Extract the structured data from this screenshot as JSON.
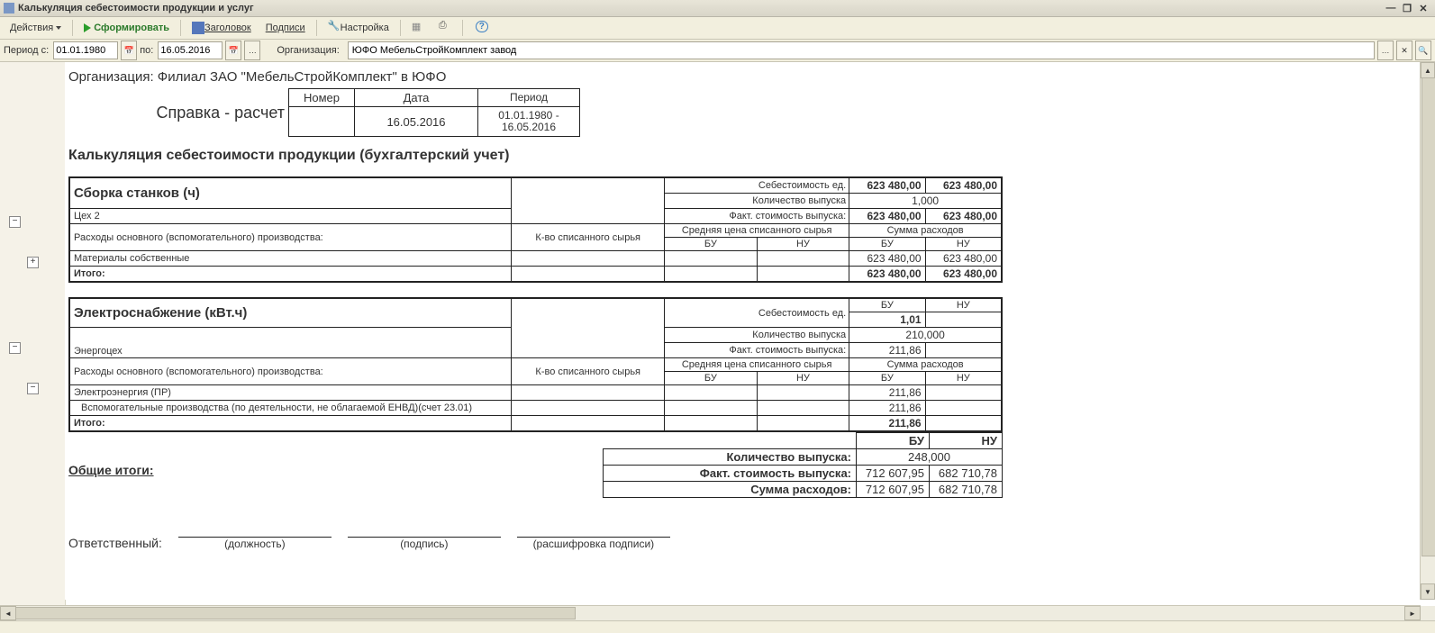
{
  "window": {
    "title": "Калькуляция себестоимости продукции и услуг"
  },
  "toolbar": {
    "actions": "Действия",
    "form": "Сформировать",
    "header": "Заголовок",
    "signatures": "Подписи",
    "setup": "Настройка"
  },
  "params": {
    "period_from_label": "Период с:",
    "date_from": "01.01.1980",
    "to_label": "по:",
    "date_to": "16.05.2016",
    "org_label": "Организация:",
    "org_value": "ЮФО МебельСтройКомплект завод"
  },
  "report": {
    "org_line": "Организация: Филиал ЗАО \"МебельСтройКомплект\" в ЮФО",
    "doc_title": "Справка - расчет",
    "doc_tbl": {
      "h_number": "Номер",
      "h_date": "Дата",
      "h_period": "Период",
      "number": "",
      "date": "16.05.2016",
      "period": "01.01.1980 - 16.05.2016"
    },
    "title": "Калькуляция себестоимости продукции (бухгалтерский учет)",
    "labels": {
      "unit_cost": "Себестоимость ед.",
      "qty_out": "Количество выпуска",
      "fact_cost": "Факт. стоимость выпуска:",
      "qty_mat": "К-во списанного сырья",
      "avg_price": "Средняя цена списанного сырья",
      "sum_cost": "Сумма расходов",
      "bu": "БУ",
      "nu": "НУ",
      "itogo": "Итого:",
      "expenses_caption": "Расходы основного (вспомогательного) производства:"
    },
    "block1": {
      "name": "Сборка станков (ч)",
      "unit": "Цех 2",
      "unit_cost_bu": "623 480,00",
      "unit_cost_nu": "623 480,00",
      "qty": "1,000",
      "fact_bu": "623 480,00",
      "fact_nu": "623 480,00",
      "rows": [
        {
          "name": "Материалы собственные",
          "bu": "623 480,00",
          "nu": "623 480,00"
        }
      ],
      "total_bu": "623 480,00",
      "total_nu": "623 480,00"
    },
    "block2": {
      "name": "Электроснабжение (кВт.ч)",
      "unit": "Энергоцех",
      "header_bu": "БУ",
      "header_nu": "НУ",
      "unit_cost": "1,01",
      "qty": "210,000",
      "fact": "211,86",
      "rows": [
        {
          "name": "Электроэнергия (ПР)",
          "bu": "211,86",
          "nu": ""
        },
        {
          "name": "Вспомогательные производства (по деятельности, не облагаемой ЕНВД)(счет 23.01)",
          "bu": "211,86",
          "nu": ""
        }
      ],
      "total": "211,86"
    },
    "totals": {
      "heading": "Общие итоги:",
      "qty_label": "Количество выпуска:",
      "qty": "248,000",
      "fact_label": "Факт. стоимость выпуска:",
      "fact_bu": "712 607,95",
      "fact_nu": "682 710,78",
      "sum_label": "Сумма расходов:",
      "sum_bu": "712 607,95",
      "sum_nu": "682 710,78",
      "bu": "БУ",
      "nu": "НУ"
    },
    "sign": {
      "responsible": "Ответственный:",
      "position": "(должность)",
      "signature": "(подпись)",
      "decoding": "(расшифровка подписи)"
    }
  }
}
